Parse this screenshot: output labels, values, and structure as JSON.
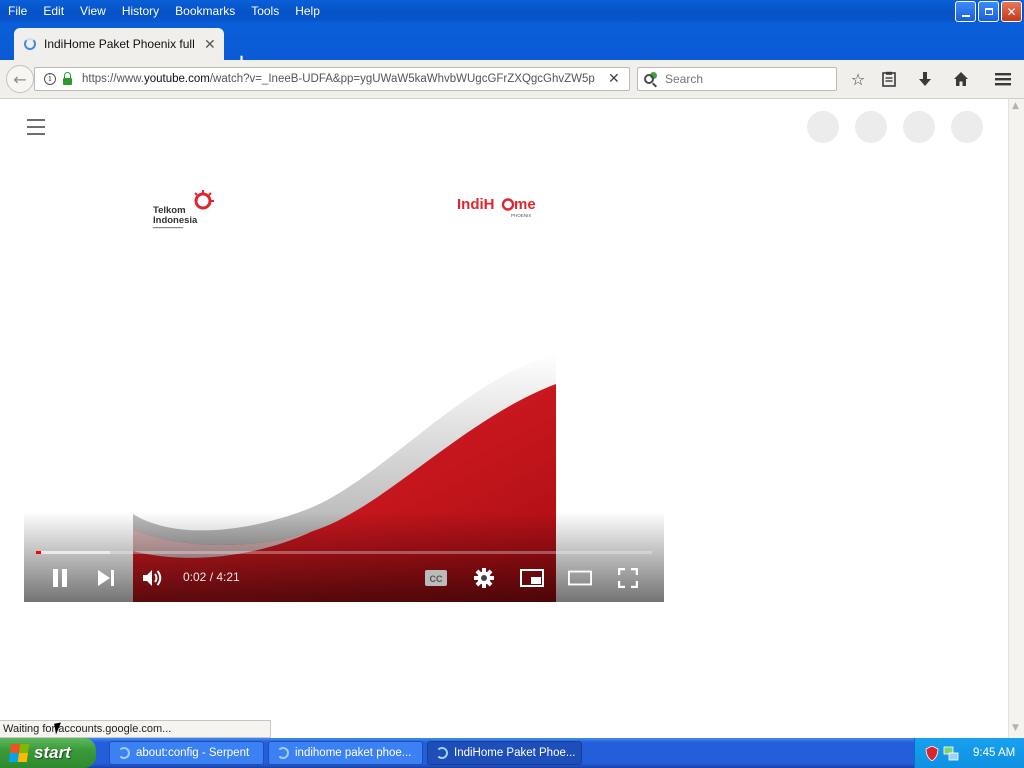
{
  "window": {
    "menu": [
      "File",
      "Edit",
      "View",
      "History",
      "Bookmarks",
      "Tools",
      "Help"
    ],
    "buttons": {
      "minimize": "minimize-icon",
      "restore": "restore-icon",
      "close": "close-icon"
    }
  },
  "tab": {
    "title": "IndiHome Paket Phoenix full version",
    "close_glyph": "✕",
    "new_tab_glyph": "+"
  },
  "navbar": {
    "url_prefix": "https://www.",
    "url_domain": "youtube.com",
    "url_rest": "/watch?v=_IneeB-UDFA&pp=ygUWaW5kaWhvbWUgcGFrZXQgcGhvZW5p",
    "search_placeholder": "Search"
  },
  "player": {
    "time": "0:02 / 4:21",
    "played_fraction": 0.0077,
    "buffered_fraction": 0.12,
    "telkom_line1": "Telkom",
    "telkom_line2": "Indonesia",
    "brand_left": "IndiH",
    "brand_right": "me",
    "brand_sub": "PHOENIX"
  },
  "status": {
    "text": "Waiting for accounts.google.com..."
  },
  "taskbar": {
    "start_label": "start",
    "tasks": [
      {
        "label": "about:config - Serpent"
      },
      {
        "label": "indihome paket phoe..."
      },
      {
        "label": "IndiHome Paket Phoe..."
      }
    ],
    "clock": "9:45 AM"
  },
  "colors": {
    "titlebar": "#0a5fd8",
    "youtube_red": "#ff0000",
    "indihome_red": "#e0262d",
    "taskbar": "#245edb",
    "start_green": "#3a9a3a"
  }
}
